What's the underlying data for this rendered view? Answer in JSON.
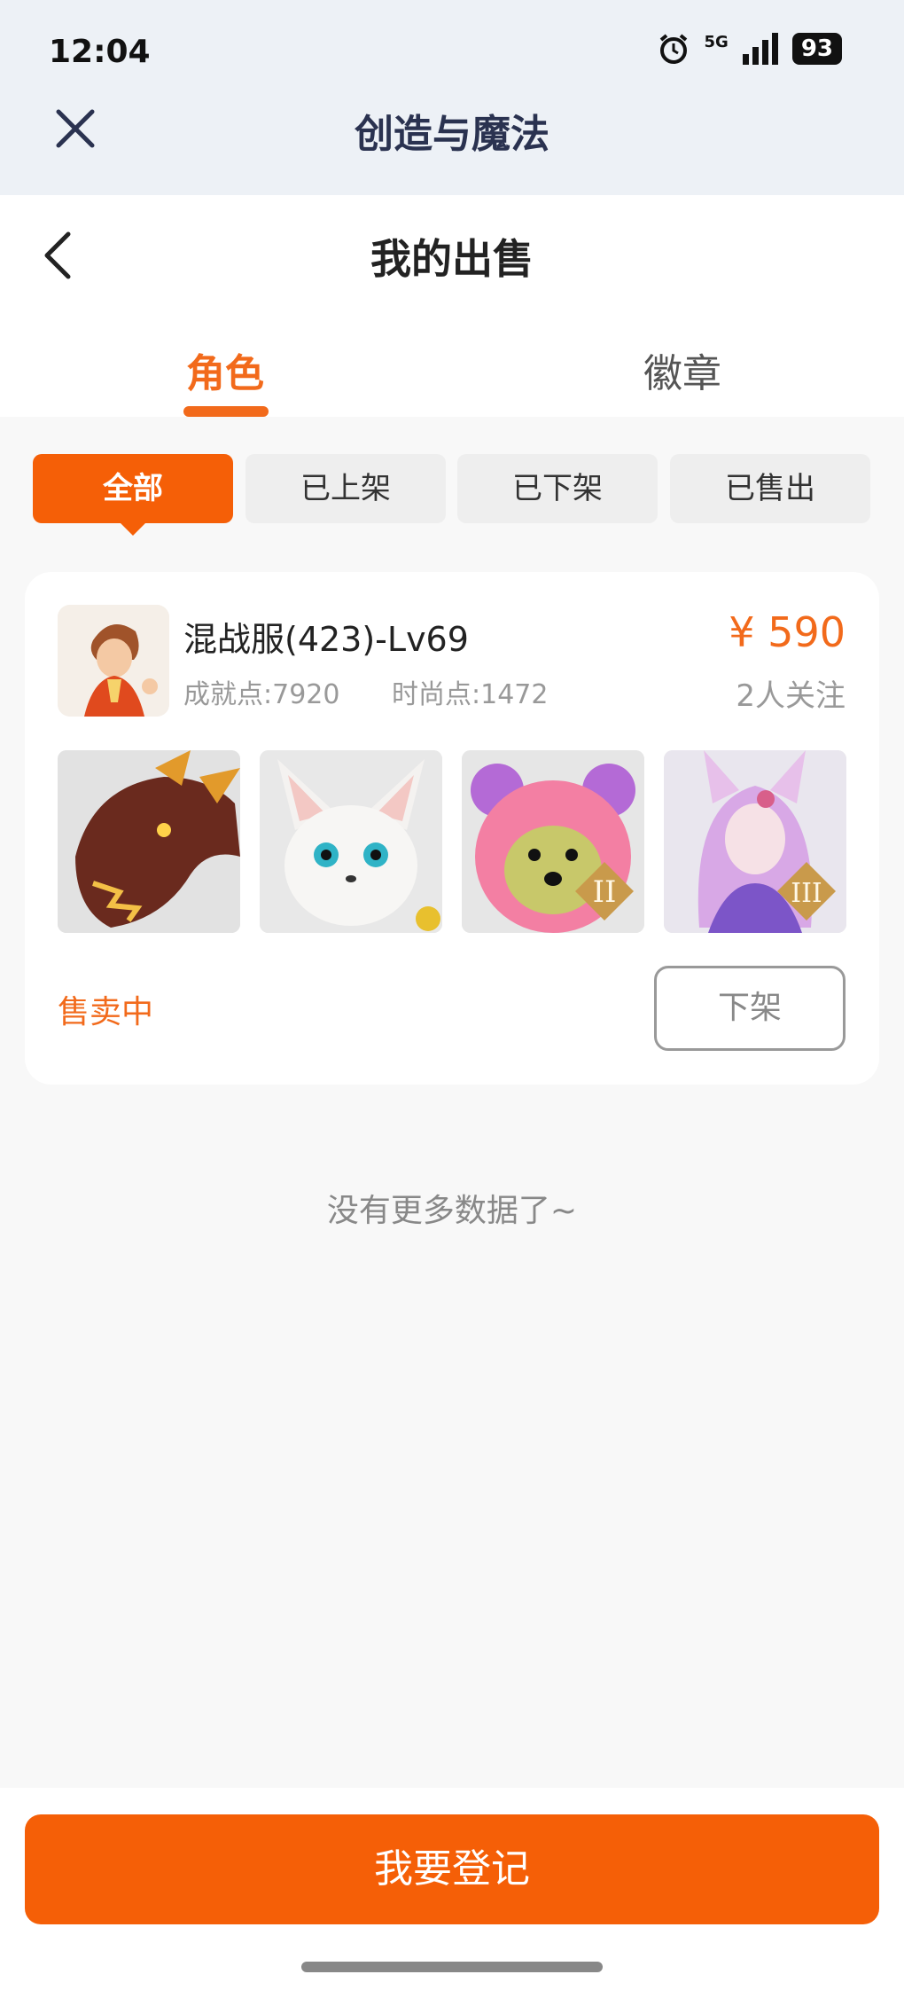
{
  "status_bar": {
    "time": "12:04",
    "network": "5G",
    "battery": "93"
  },
  "app": {
    "title": "创造与魔法"
  },
  "page": {
    "title": "我的出售"
  },
  "tabs": [
    {
      "label": "角色",
      "active": true
    },
    {
      "label": "徽章",
      "active": false
    }
  ],
  "filters": [
    {
      "label": "全部",
      "active": true
    },
    {
      "label": "已上架",
      "active": false
    },
    {
      "label": "已下架",
      "active": false
    },
    {
      "label": "已售出",
      "active": false
    }
  ],
  "listing": {
    "name": "混战服(423)-Lv69",
    "achievement": "成就点:7920",
    "fashion": "时尚点:1472",
    "price": "¥ 590",
    "followers": "2人关注",
    "status": "售卖中",
    "delist_label": "下架",
    "items": [
      {
        "icon": "dragon-mount-icon"
      },
      {
        "icon": "white-fox-pet-icon"
      },
      {
        "icon": "pink-bear-pet-icon",
        "tier": "II"
      },
      {
        "icon": "fox-spirit-pet-icon",
        "tier": "III"
      }
    ]
  },
  "empty_text": "没有更多数据了~",
  "footer": {
    "register_label": "我要登记"
  },
  "colors": {
    "accent": "#f55f07",
    "accent_text": "#f26a1b"
  }
}
